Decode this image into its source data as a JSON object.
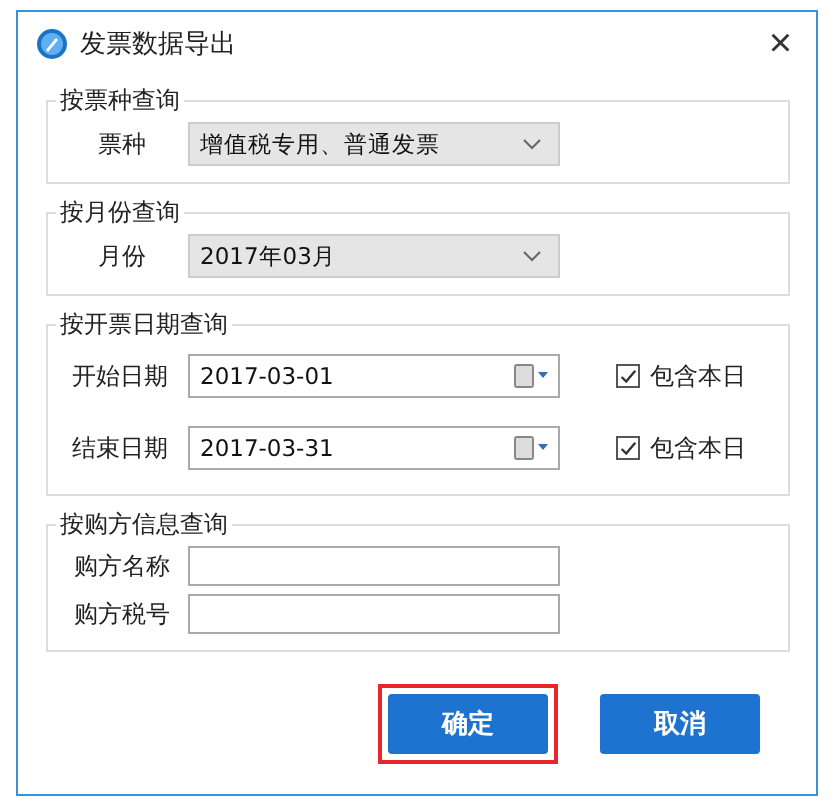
{
  "window": {
    "title": "发票数据导出",
    "close": "×"
  },
  "groups": [
    {
      "title": "按票种查询",
      "kind": "select",
      "rows": [
        {
          "label": "票种",
          "value": "增值税专用、普通发票"
        }
      ]
    },
    {
      "title": "按月份查询",
      "kind": "select",
      "rows": [
        {
          "label": "月份",
          "value": "2017年03月"
        }
      ]
    },
    {
      "title": "按开票日期查询",
      "kind": "date",
      "rows": [
        {
          "label": "开始日期",
          "value": "2017-03-01",
          "checked": true,
          "check_label": "包含本日"
        },
        {
          "label": "结束日期",
          "value": "2017-03-31",
          "checked": true,
          "check_label": "包含本日"
        }
      ]
    },
    {
      "title": "按购方信息查询",
      "kind": "text",
      "rows": [
        {
          "label": "购方名称"
        },
        {
          "label": "购方税号"
        }
      ]
    }
  ],
  "buttons": [
    {
      "label": "确定",
      "highlighted": true
    },
    {
      "label": "取消",
      "highlighted": false
    }
  ]
}
